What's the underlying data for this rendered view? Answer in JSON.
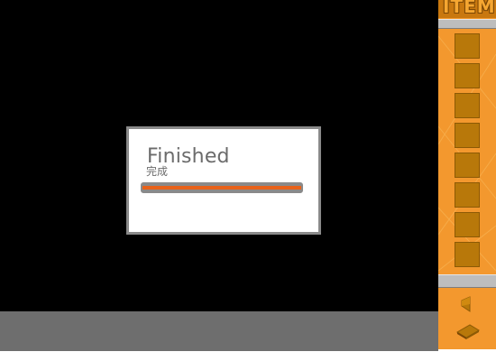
{
  "dialog": {
    "title": "Finished",
    "subtitle": "完成",
    "progress": 1.0
  },
  "sidebar": {
    "header": "ITEM",
    "slot_count": 8
  },
  "colors": {
    "background": "#000000",
    "bottom_bar": "#6e6e6e",
    "sidebar": "#f3982e",
    "slot": "#b8780a",
    "progress_fill": "#e8621a",
    "dialog_border": "#8a8a8a"
  },
  "icons": [
    "arrow-icon",
    "back-icon"
  ]
}
